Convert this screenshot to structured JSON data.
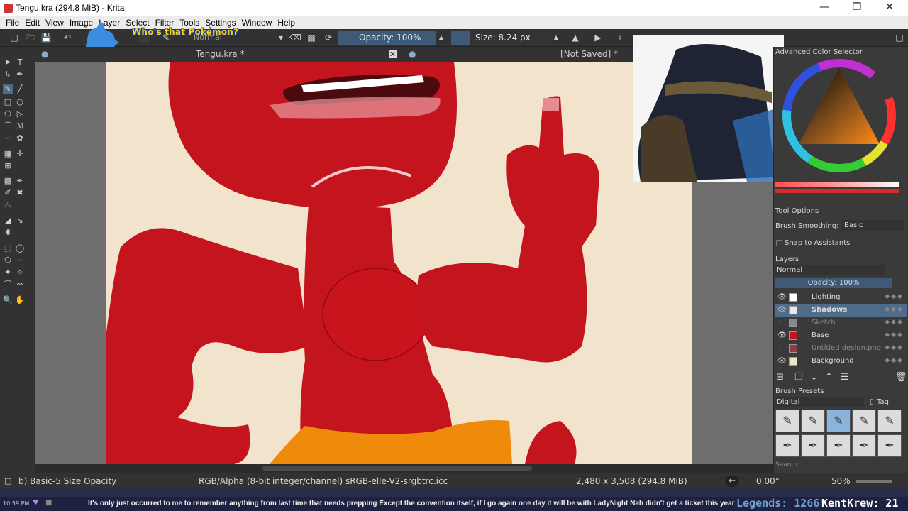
{
  "window": {
    "title": "Tengu.kra (294.8 MiB) - Krita"
  },
  "menu": [
    "File",
    "Edit",
    "View",
    "Image",
    "Layer",
    "Select",
    "Filter",
    "Tools",
    "Settings",
    "Window",
    "Help"
  ],
  "toolbar": {
    "blend_mode": "Normal",
    "opacity_label": "Opacity: 100%",
    "size_label": "Size: 8.24 px"
  },
  "overlay": {
    "pokemon_text": "Who's that Pokémon?"
  },
  "tabs": [
    {
      "label": "Tengu.kra *"
    },
    {
      "label": "[Not Saved]  *"
    }
  ],
  "docker": {
    "color_selector_title": "Advanced Color Selector",
    "tool_options_title": "Tool Options",
    "brush_smoothing_label": "Brush Smoothing:",
    "brush_smoothing_value": "Basic",
    "snap_label": "Snap to Assistants",
    "layers_title": "Layers",
    "layers_blend": "Normal",
    "layers_opacity": "Opacity:  100%",
    "layers": [
      {
        "name": "Lighting",
        "visible": true,
        "selected": false,
        "thumb": "#ffffff"
      },
      {
        "name": "Shadows",
        "visible": true,
        "selected": true,
        "thumb": "#f0e6e6"
      },
      {
        "name": "Sketch",
        "visible": false,
        "selected": false,
        "thumb": "#888888"
      },
      {
        "name": "Base",
        "visible": true,
        "selected": false,
        "thumb": "#c0141e"
      },
      {
        "name": "Untitled design.png",
        "visible": false,
        "selected": false,
        "thumb": "#8a4040"
      },
      {
        "name": "Background",
        "visible": true,
        "selected": false,
        "thumb": "#f2e3cc"
      }
    ],
    "brush_presets_title": "Brush Presets",
    "preset_filter": "Digital",
    "tag_label": "Tag",
    "search_placeholder": "Search"
  },
  "status": {
    "brush": "b) Basic-5 Size Opacity",
    "colorspace": "RGB/Alpha (8-bit integer/channel)  sRGB-elle-V2-srgbtrc.icc",
    "dimensions": "2,480 x 3,508 (294.8 MiB)",
    "rotation": "0.00°",
    "zoom": "50%"
  },
  "ticker": {
    "time": "10:59 PM",
    "message": "It's only just occurred to me to remember anything from last time that needs prepping   Except the convention itself, if I go again one day it will be with LadyNight  Nah didn't get a ticket this year",
    "legends": "Legends: 1266",
    "krew": "KentKrew: 21"
  },
  "colors": {
    "canvas_bg": "#f2e3cc",
    "skin": "#c4141e",
    "shorts": "#f08a0a",
    "accent": "#3e5a77"
  }
}
